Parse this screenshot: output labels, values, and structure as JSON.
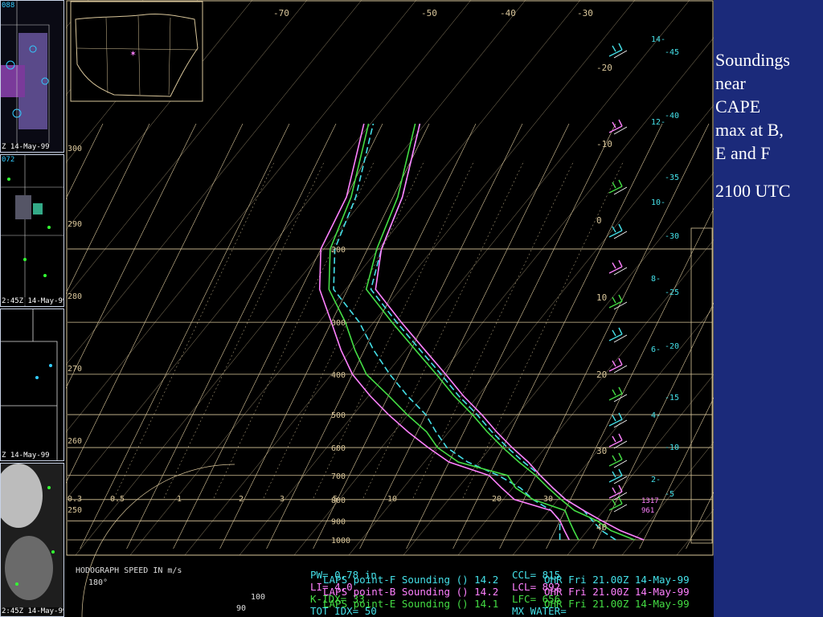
{
  "side_panel": {
    "title_lines": [
      "Soundings",
      "near",
      "CAPE",
      "max at B,",
      "E and F"
    ],
    "time": "2100 UTC"
  },
  "thumbnails": [
    {
      "timestamp": "Z 14-May-99",
      "top_label": "088"
    },
    {
      "timestamp": "2:45Z 14-May-99",
      "top_label": "072"
    },
    {
      "timestamp": "Z 14-May-99",
      "top_label": ""
    },
    {
      "timestamp": "2:45Z 14-May-99",
      "top_label": ""
    }
  ],
  "legend": {
    "hodograph_label": "HODOGRAPH SPEED IN m/s",
    "hodo_ticks": [
      "180°",
      "100",
      "90"
    ],
    "lines": [
      {
        "text": "LAPS point-F Sounding () 14.2",
        "color": "#44e0e8"
      },
      {
        "text": "LAPS point-B Sounding () 14.2",
        "color": "#ff80ff"
      },
      {
        "text": "LAPS point-E Sounding () 14.1",
        "color": "#44dd44"
      }
    ],
    "right_lines": [
      {
        "text": "OHR Fri 21.00Z 14-May-99",
        "color": "#44e0e8"
      },
      {
        "text": "OHR Fri 21.00Z 14-May-99",
        "color": "#ff80ff"
      },
      {
        "text": "OHR Fri 21.00Z 14-May-99",
        "color": "#44dd44"
      }
    ],
    "indices": [
      "PW= 0.78 in",
      "LI= 4.0",
      "K-IDX= 33",
      "TOT IDX= 50"
    ],
    "ccl": [
      "CCL= 815",
      "LCL= 892",
      "LFC= 656",
      "MX WATER="
    ]
  },
  "chart_data": {
    "type": "line",
    "title": "",
    "pressure_levels": [
      200,
      300,
      400,
      500,
      600,
      700,
      800,
      900,
      1000
    ],
    "temp_isotherm_labels": [
      -70,
      -50,
      -40,
      -30,
      -20,
      -10,
      0,
      10,
      20,
      30,
      40
    ],
    "dry_adiabat_labels": [
      300,
      290,
      280,
      270,
      260,
      250
    ],
    "mixing_ratio_labels": [
      "0.3",
      "0.5",
      "1",
      "2",
      "3",
      "5",
      "10",
      "20",
      "30"
    ],
    "height_scale_km": [
      "14",
      "12",
      "10",
      "8",
      "6",
      "4",
      "2"
    ],
    "height_scale_c": [
      "-45",
      "-40",
      "-35",
      "-30",
      "-25",
      "-20",
      "-15",
      "-10",
      "-5"
    ],
    "bottom_labels": [
      "1317",
      "961"
    ],
    "series": [
      {
        "name": "LAPS point-F",
        "color": "#44e0e8",
        "style": "temp",
        "points": [
          [
            1000,
            24
          ],
          [
            950,
            20
          ],
          [
            900,
            17
          ],
          [
            850,
            14
          ],
          [
            800,
            9
          ],
          [
            750,
            5
          ],
          [
            700,
            1
          ],
          [
            650,
            -4
          ],
          [
            600,
            -9
          ],
          [
            550,
            -14
          ],
          [
            500,
            -19
          ],
          [
            450,
            -25
          ],
          [
            400,
            -31
          ],
          [
            350,
            -38
          ],
          [
            300,
            -46
          ],
          [
            250,
            -55
          ],
          [
            200,
            -57
          ],
          [
            150,
            -58
          ],
          [
            100,
            -62
          ]
        ]
      },
      {
        "name": "LAPS point-F",
        "color": "#44e0e8",
        "style": "dew",
        "points": [
          [
            1000,
            12
          ],
          [
            950,
            11
          ],
          [
            900,
            10
          ],
          [
            850,
            7
          ],
          [
            800,
            2
          ],
          [
            750,
            -2
          ],
          [
            700,
            -8
          ],
          [
            650,
            -16
          ],
          [
            600,
            -22
          ],
          [
            550,
            -26
          ],
          [
            500,
            -30
          ],
          [
            450,
            -36
          ],
          [
            400,
            -42
          ],
          [
            350,
            -48
          ],
          [
            300,
            -54
          ],
          [
            250,
            -63
          ],
          [
            200,
            -67
          ],
          [
            150,
            -68
          ],
          [
            100,
            -72
          ]
        ]
      },
      {
        "name": "LAPS point-B",
        "color": "#ff80ff",
        "style": "temp",
        "points": [
          [
            1000,
            30
          ],
          [
            950,
            24
          ],
          [
            900,
            19
          ],
          [
            850,
            14
          ],
          [
            800,
            9
          ],
          [
            750,
            5
          ],
          [
            700,
            1
          ],
          [
            650,
            -3
          ],
          [
            600,
            -8
          ],
          [
            550,
            -13
          ],
          [
            500,
            -18
          ],
          [
            450,
            -24
          ],
          [
            400,
            -30
          ],
          [
            350,
            -37
          ],
          [
            300,
            -45
          ],
          [
            250,
            -54
          ],
          [
            200,
            -57
          ],
          [
            150,
            -58
          ],
          [
            100,
            -62
          ]
        ]
      },
      {
        "name": "LAPS point-B",
        "color": "#ff80ff",
        "style": "dew",
        "points": [
          [
            1000,
            14
          ],
          [
            950,
            12
          ],
          [
            900,
            10
          ],
          [
            850,
            7
          ],
          [
            800,
            -2
          ],
          [
            750,
            -6
          ],
          [
            700,
            -10
          ],
          [
            650,
            -20
          ],
          [
            600,
            -26
          ],
          [
            550,
            -32
          ],
          [
            500,
            -38
          ],
          [
            450,
            -44
          ],
          [
            400,
            -50
          ],
          [
            350,
            -55
          ],
          [
            300,
            -60
          ],
          [
            250,
            -66
          ],
          [
            200,
            -70
          ],
          [
            150,
            -70
          ],
          [
            100,
            -74
          ]
        ]
      },
      {
        "name": "LAPS point-E",
        "color": "#44dd44",
        "style": "temp",
        "points": [
          [
            1000,
            28
          ],
          [
            950,
            22
          ],
          [
            900,
            18
          ],
          [
            850,
            12
          ],
          [
            800,
            8
          ],
          [
            750,
            4
          ],
          [
            700,
            0
          ],
          [
            650,
            -5
          ],
          [
            600,
            -10
          ],
          [
            550,
            -15
          ],
          [
            500,
            -20
          ],
          [
            450,
            -26
          ],
          [
            400,
            -32
          ],
          [
            350,
            -39
          ],
          [
            300,
            -47
          ],
          [
            250,
            -56
          ],
          [
            200,
            -58
          ],
          [
            150,
            -59
          ],
          [
            100,
            -63
          ]
        ]
      },
      {
        "name": "LAPS point-E",
        "color": "#44dd44",
        "style": "dew",
        "points": [
          [
            1000,
            16
          ],
          [
            950,
            14
          ],
          [
            900,
            12
          ],
          [
            850,
            10
          ],
          [
            800,
            2
          ],
          [
            750,
            -3
          ],
          [
            700,
            -6
          ],
          [
            650,
            -18
          ],
          [
            600,
            -24
          ],
          [
            550,
            -28
          ],
          [
            500,
            -34
          ],
          [
            450,
            -40
          ],
          [
            400,
            -47
          ],
          [
            350,
            -52
          ],
          [
            300,
            -57
          ],
          [
            250,
            -64
          ],
          [
            200,
            -68
          ],
          [
            150,
            -69
          ],
          [
            100,
            -73
          ]
        ]
      }
    ]
  }
}
